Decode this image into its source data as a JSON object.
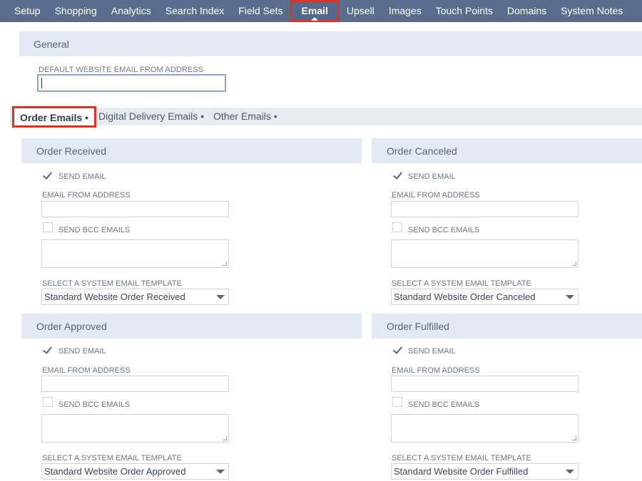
{
  "nav": {
    "items": [
      "Setup",
      "Shopping",
      "Analytics",
      "Search Index",
      "Field Sets",
      "Email",
      "Upsell",
      "Images",
      "Touch Points",
      "Domains",
      "System Notes"
    ],
    "active": "Email"
  },
  "general": {
    "title": "General",
    "default_email_label": "DEFAULT WEBSITE EMAIL FROM ADDRESS",
    "default_email_value": ""
  },
  "subtabs": {
    "items": [
      "Order Emails •",
      "Digital Delivery Emails •",
      "Other Emails •"
    ],
    "active": "Order Emails •"
  },
  "labels": {
    "send_email": "SEND EMAIL",
    "from_address": "EMAIL FROM ADDRESS",
    "send_bcc": "SEND BCC EMAILS",
    "select_template": "SELECT A SYSTEM EMAIL TEMPLATE"
  },
  "panels": [
    {
      "title": "Order Received",
      "send_email": true,
      "send_bcc": false,
      "template": "Standard Website Order Received"
    },
    {
      "title": "Order Canceled",
      "send_email": true,
      "send_bcc": false,
      "template": "Standard Website Order Canceled"
    },
    {
      "title": "Order Approved",
      "send_email": true,
      "send_bcc": false,
      "template": "Standard Website Order Approved"
    },
    {
      "title": "Order Fulfilled",
      "send_email": true,
      "send_bcc": false,
      "template": "Standard Website Order Fulfilled"
    }
  ],
  "colors": {
    "nav_bg": "#5b6d8c",
    "highlight": "#e2321f",
    "section_bg": "#e4eaf4"
  }
}
